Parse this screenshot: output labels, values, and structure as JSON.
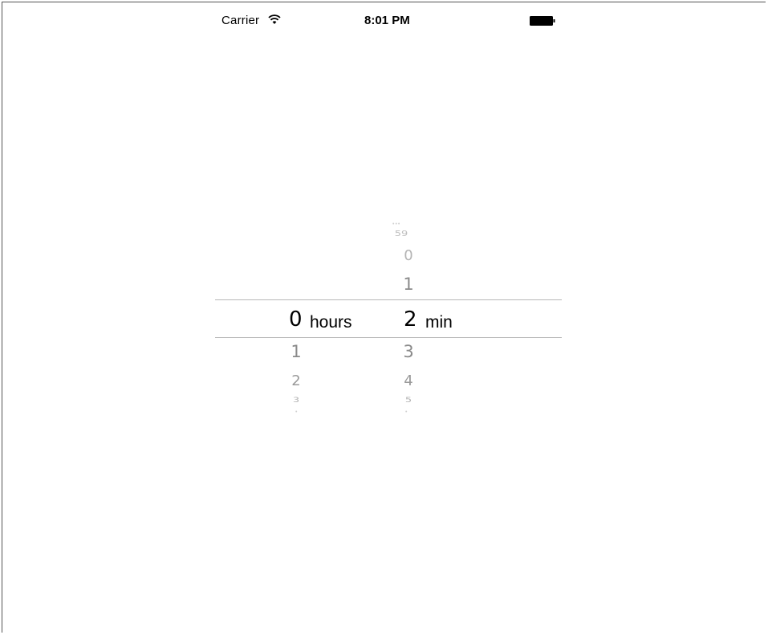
{
  "status_bar": {
    "carrier": "Carrier",
    "time": "8:01 PM",
    "wifi_icon": "wifi-icon",
    "battery_icon": "battery-icon"
  },
  "picker": {
    "hours": {
      "selected": "0",
      "unit": "hours",
      "above": [],
      "below": [
        "1",
        "2",
        "3"
      ]
    },
    "minutes": {
      "selected": "2",
      "unit": "min",
      "above": [
        "59",
        "0",
        "1"
      ],
      "below": [
        "3",
        "4",
        "5"
      ]
    }
  }
}
